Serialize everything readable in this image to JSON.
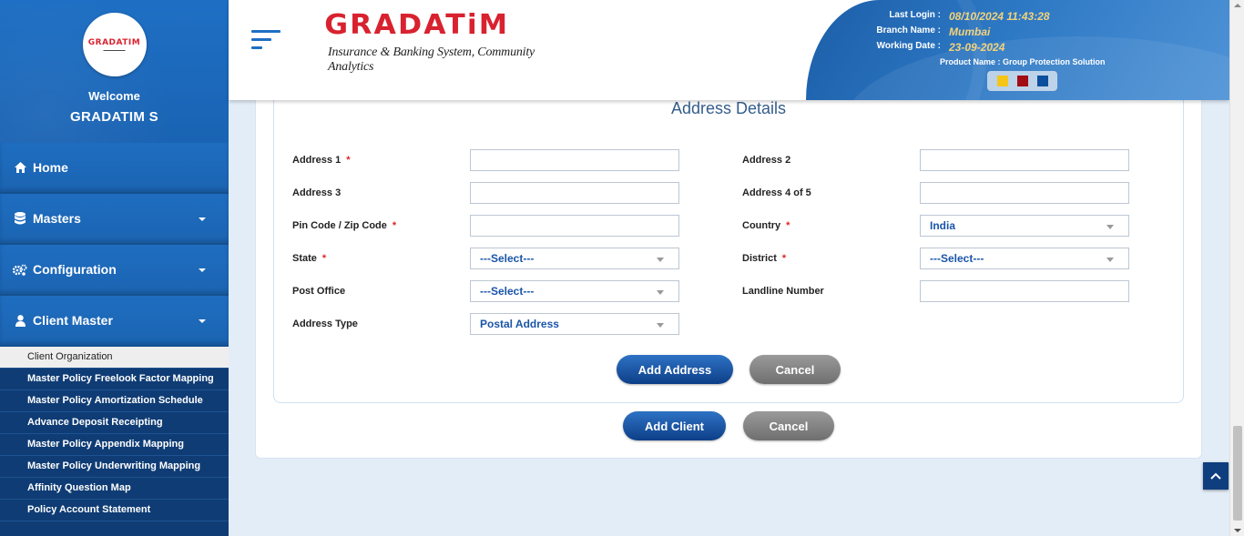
{
  "sidebar": {
    "logo_text": "GRADATIM",
    "welcome": "Welcome",
    "username": "GRADATIM S",
    "nav": [
      {
        "label": "Home",
        "icon": "home-icon"
      },
      {
        "label": "Masters",
        "icon": "database-icon"
      },
      {
        "label": "Configuration",
        "icon": "gears-icon"
      },
      {
        "label": "Client Master",
        "icon": "user-icon"
      }
    ],
    "submenu": [
      "Client Organization",
      "Master Policy Freelook Factor Mapping",
      "Master Policy Amortization Schedule",
      "Advance Deposit Receipting",
      "Master Policy Appendix Mapping",
      "Master Policy Underwriting Mapping",
      "Affinity Question Map",
      "Policy Account Statement"
    ]
  },
  "header": {
    "brand_name": "GRADATiM",
    "brand_tagline": "Insurance & Banking System, Community Analytics",
    "last_login_label": "Last Login :",
    "last_login": "08/10/2024 11:43:28",
    "branch_label": "Branch Name :",
    "branch": "Mumbai",
    "working_date_label": "Working Date :",
    "working_date": "23-09-2024",
    "product": "Product Name : Group Protection Solution",
    "theme_colors": [
      "#f5c518",
      "#a10d12",
      "#0b4f9c"
    ]
  },
  "form": {
    "title": "Address Details",
    "labels": {
      "address1": "Address 1",
      "address2": "Address 2",
      "address3": "Address 3",
      "address4": "Address 4 of 5",
      "pincode": "Pin Code / Zip Code",
      "country": "Country",
      "state": "State",
      "district": "District",
      "post_office": "Post Office",
      "landline": "Landline Number",
      "address_type": "Address Type"
    },
    "required_mark": "*",
    "values": {
      "country": "India",
      "state": "---Select---",
      "district": "---Select---",
      "post_office": "---Select---",
      "address_type": "Postal Address"
    },
    "buttons": {
      "add_address": "Add Address",
      "cancel": "Cancel",
      "add_client": "Add Client",
      "cancel2": "Cancel"
    }
  },
  "colors": {
    "primary": "#1e6fc4",
    "sidebar_dark": "#0f3c74",
    "brand_red": "#d8222f"
  }
}
